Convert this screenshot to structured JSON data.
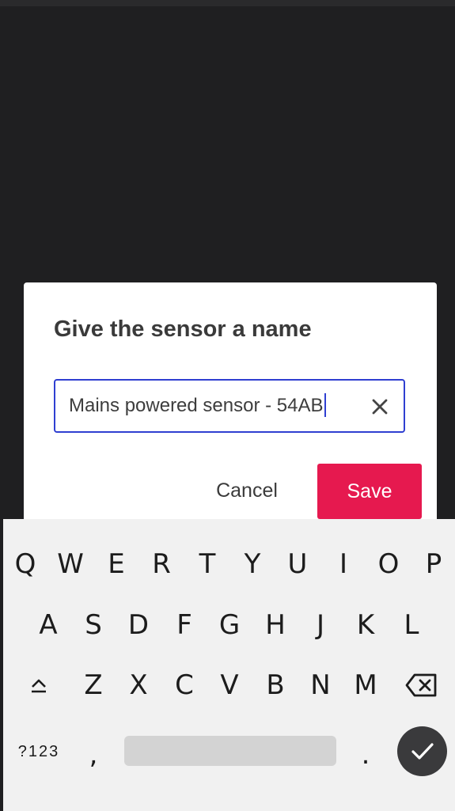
{
  "dialog": {
    "title": "Give the sensor a name",
    "input_value": "Mains powered sensor - 54AB",
    "cancel_label": "Cancel",
    "save_label": "Save"
  },
  "colors": {
    "background": "#1f1f21",
    "accent": "#e6194f",
    "field_border": "#2f3fd1",
    "keyboard_bg": "#f1f1f1"
  },
  "keyboard": {
    "row1": [
      "Q",
      "W",
      "E",
      "R",
      "T",
      "Y",
      "U",
      "I",
      "O",
      "P"
    ],
    "row2": [
      "A",
      "S",
      "D",
      "F",
      "G",
      "H",
      "J",
      "K",
      "L"
    ],
    "row3": [
      "Z",
      "X",
      "C",
      "V",
      "B",
      "N",
      "M"
    ],
    "symbols_label": "?123",
    "comma": ",",
    "period": "."
  },
  "icons": {
    "clear": "close-icon",
    "shift": "shift-icon",
    "backspace": "backspace-icon",
    "enter": "check-icon"
  }
}
